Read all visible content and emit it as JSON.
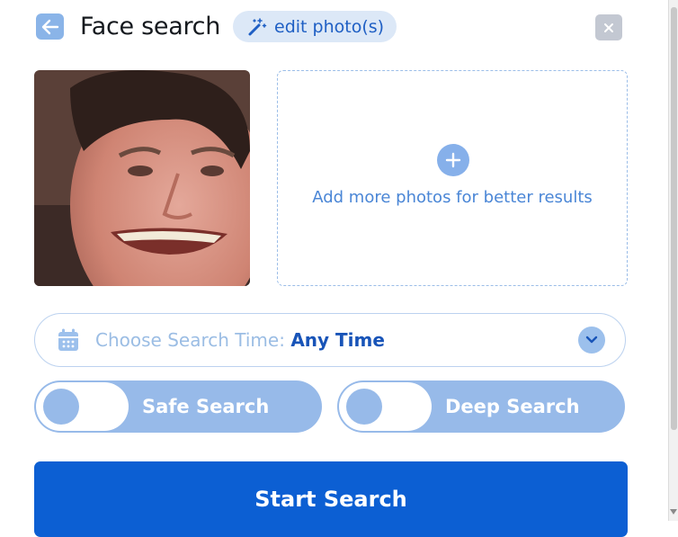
{
  "header": {
    "title": "Face search",
    "edit_label": "edit photo(s)",
    "back_icon": "arrow-left-icon",
    "edit_icon": "magic-wand-icon",
    "close_icon": "close-icon"
  },
  "upload": {
    "add_more_text": "Add more photos for better results",
    "add_icon": "plus-icon"
  },
  "time_filter": {
    "label": "Choose Search Time:",
    "value": "Any Time",
    "icon": "calendar-icon",
    "dropdown_icon": "chevron-down-icon"
  },
  "toggles": [
    {
      "label": "Safe Search",
      "on": false
    },
    {
      "label": "Deep Search",
      "on": false
    }
  ],
  "start_button": {
    "label": "Start Search"
  },
  "colors": {
    "primary": "#0c5fd3",
    "accent_light": "#97bae9",
    "link": "#4a86d6"
  }
}
